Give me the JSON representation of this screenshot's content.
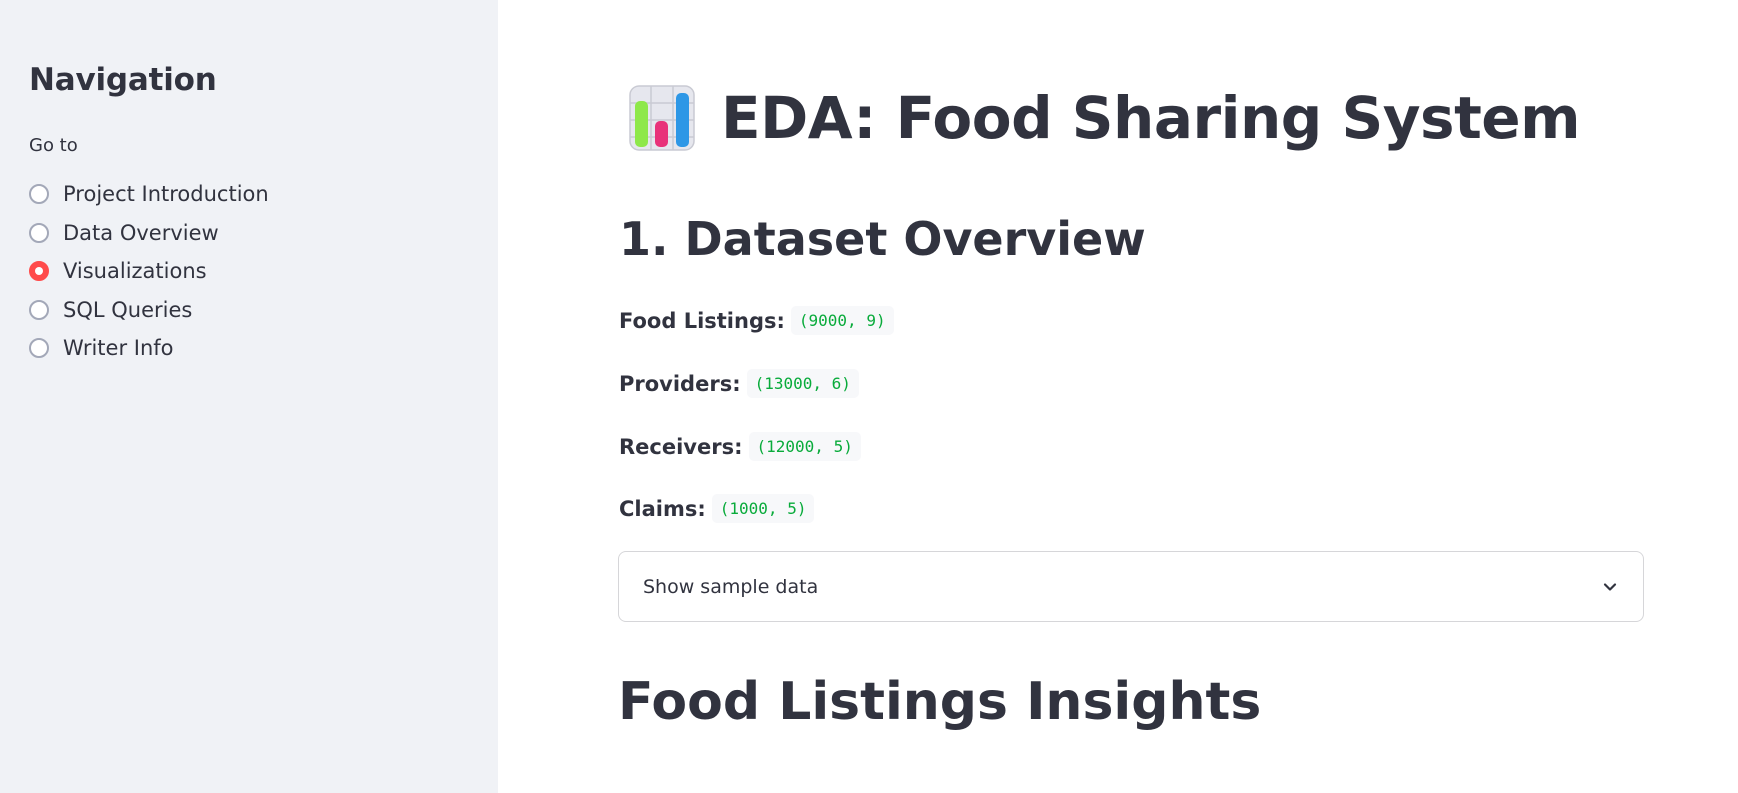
{
  "sidebar": {
    "title": "Navigation",
    "goto_label": "Go to",
    "items": [
      {
        "label": "Project Introduction",
        "selected": false
      },
      {
        "label": "Data Overview",
        "selected": false
      },
      {
        "label": "Visualizations",
        "selected": true
      },
      {
        "label": "SQL Queries",
        "selected": false
      },
      {
        "label": "Writer Info",
        "selected": false
      }
    ]
  },
  "main": {
    "title": "EDA: Food Sharing System",
    "title_icon": "bar-chart-emoji-icon",
    "section_heading": "1. Dataset Overview",
    "stats": [
      {
        "label": "Food Listings:",
        "value": "(9000, 9)"
      },
      {
        "label": "Providers:",
        "value": "(13000, 6)"
      },
      {
        "label": "Receivers:",
        "value": "(12000, 5)"
      },
      {
        "label": "Claims:",
        "value": "(1000, 5)"
      }
    ],
    "expander_label": "Show sample data",
    "next_heading": "Food Listings Insights"
  },
  "colors": {
    "accent": "#ff4b4b",
    "code_text": "#09ab3b",
    "sidebar_bg": "#f0f2f6",
    "text": "#31333f"
  }
}
